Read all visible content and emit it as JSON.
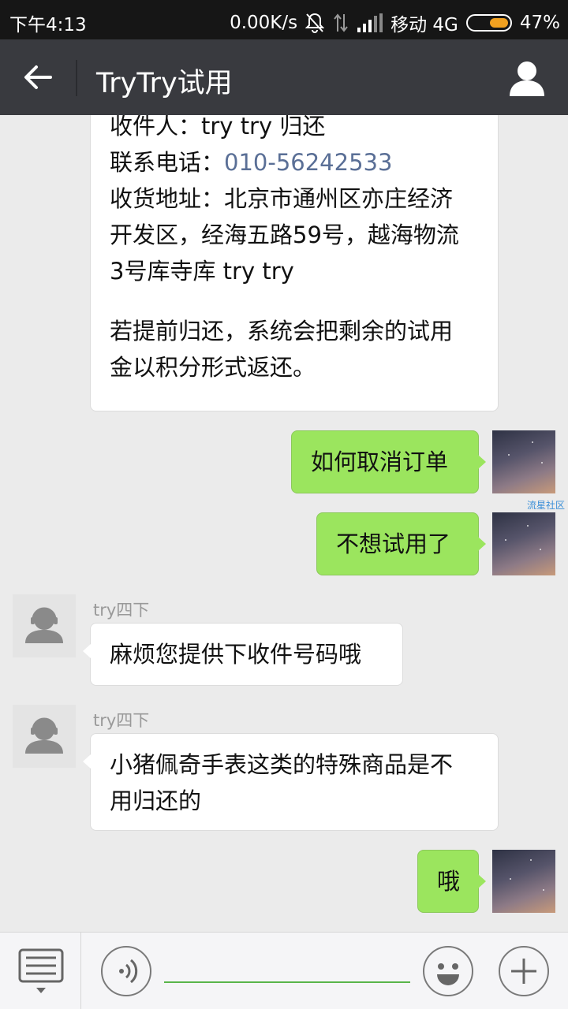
{
  "status_bar": {
    "time": "下午4:13",
    "speed": "0.00K/s",
    "carrier": "移动 4G",
    "battery": "47%",
    "battery_level": 0.47
  },
  "header": {
    "title": "TryTry试用",
    "back_icon": "arrow-left-icon",
    "profile_icon": "person-icon"
  },
  "chat": {
    "address_message": {
      "recipient_label": "收件人：",
      "recipient": "try try 归还",
      "phone_label": "联系电话：",
      "phone": "010-56242533",
      "address_label": "收货地址：",
      "address_line1": "北京市通州区亦庄经济",
      "address_line2": "开发区，经海五路59号，越海物流",
      "address_line3": "3号库寺库 try try",
      "note_line1": "若提前归还，系统会把剩余的试用",
      "note_line2": "金以积分形式返还。"
    },
    "my_message_1": "如何取消订单",
    "watermark": "流星社区",
    "my_message_2": "不想试用了",
    "bot_sender_1": "try四下",
    "bot_message_1": "麻烦您提供下收件号码哦",
    "bot_sender_2": "try四下",
    "bot_message_2_line1": "小猪佩奇手表这类的特殊商品是不",
    "bot_message_2_line2": "用归还的",
    "my_message_3": "哦"
  },
  "input_bar": {
    "text_value": "",
    "menu_icon": "list-menu-icon",
    "voice_icon": "voice-icon",
    "emoji_icon": "smiley-icon",
    "plus_icon": "plus-icon"
  },
  "colors": {
    "titlebar": "#393a3f",
    "out_bubble": "#9be55e",
    "link": "#5a6f96",
    "accent": "#59b54a"
  }
}
